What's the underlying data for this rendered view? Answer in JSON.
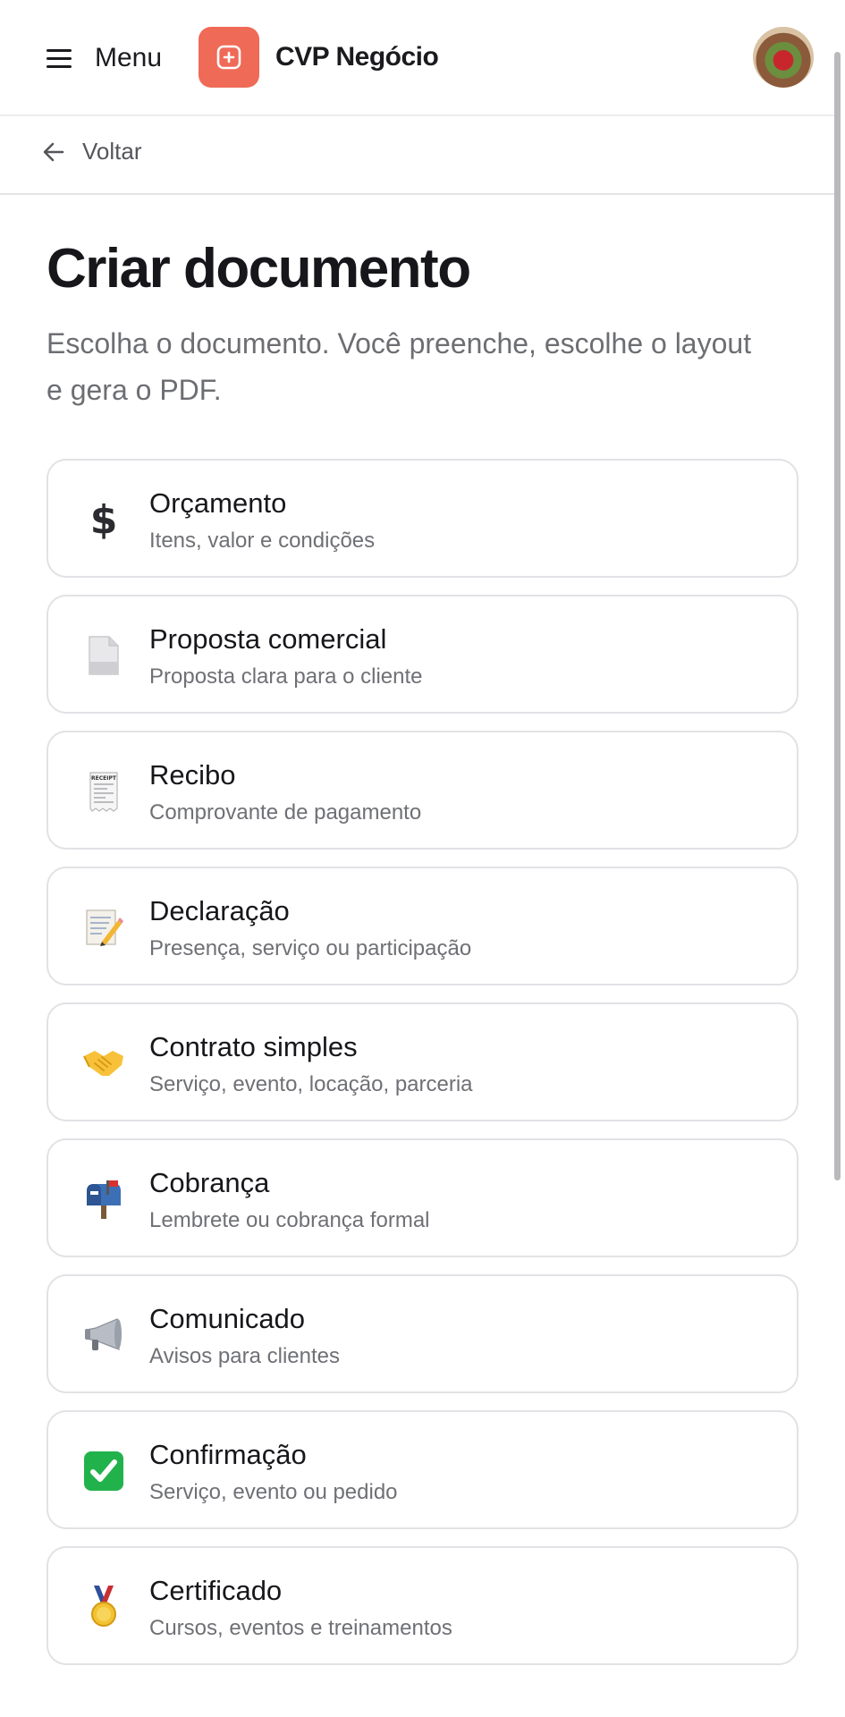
{
  "header": {
    "menu_label": "Menu",
    "brand_name": "CVP Negócio",
    "brand_color": "#ef6a57",
    "brand_icon": "plus-badge-icon",
    "avatar_icon": "user-avatar"
  },
  "nav": {
    "back_label": "Voltar",
    "back_icon": "arrow-left-icon"
  },
  "main": {
    "title": "Criar documento",
    "subtitle": "Escolha o documento. Você preenche, escolhe o layout e gera o PDF.",
    "documents": [
      {
        "label": "Orçamento",
        "description": "Itens, valor e condições",
        "icon": "dollar-icon"
      },
      {
        "label": "Proposta comercial",
        "description": "Proposta clara para o cliente",
        "icon": "page-icon"
      },
      {
        "label": "Recibo",
        "description": "Comprovante de pagamento",
        "icon": "receipt-icon",
        "icon_text": "RECEIPT"
      },
      {
        "label": "Declaração",
        "description": "Presença, serviço ou participação",
        "icon": "memo-pencil-icon"
      },
      {
        "label": "Contrato simples",
        "description": "Serviço, evento, locação, parceria",
        "icon": "handshake-icon"
      },
      {
        "label": "Cobrança",
        "description": "Lembrete ou cobrança formal",
        "icon": "mailbox-icon"
      },
      {
        "label": "Comunicado",
        "description": "Avisos para clientes",
        "icon": "megaphone-icon"
      },
      {
        "label": "Confirmação",
        "description": "Serviço, evento ou pedido",
        "icon": "check-mark-icon"
      },
      {
        "label": "Certificado",
        "description": "Cursos, eventos e treinamentos",
        "icon": "medal-icon"
      }
    ]
  }
}
